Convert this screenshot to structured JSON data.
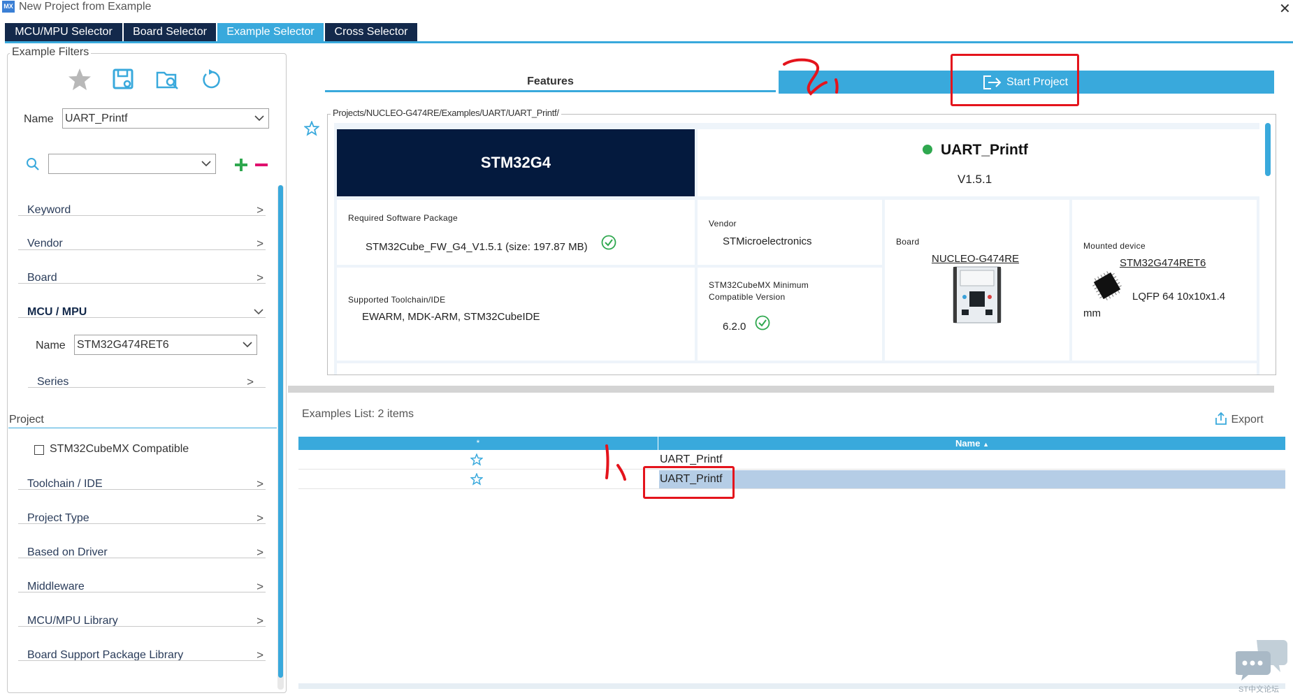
{
  "window": {
    "logo": "MX",
    "title": "New Project from Example",
    "close_glyph": "✕"
  },
  "tabs": [
    {
      "label": "MCU/MPU Selector",
      "active": false
    },
    {
      "label": "Board Selector",
      "active": false
    },
    {
      "label": "Example Selector",
      "active": true
    },
    {
      "label": "Cross Selector",
      "active": false
    }
  ],
  "filters": {
    "legend": "Example Filters",
    "toolbar_icons": [
      "star-icon",
      "save-icon",
      "open-folder-icon",
      "reset-icon"
    ],
    "name_label": "Name",
    "name_value": "UART_Printf",
    "search_value": "",
    "sections_top": [
      {
        "label": "Keyword"
      },
      {
        "label": "Vendor"
      },
      {
        "label": "Board"
      }
    ],
    "mcu_section": {
      "label": "MCU / MPU",
      "name_label": "Name",
      "name_value": "STM32G474RET6",
      "series_label": "Series"
    },
    "project_label": "Project",
    "compatible_label": "STM32CubeMX Compatible",
    "compatible_checked": false,
    "sections_bottom": [
      {
        "label": "Toolchain / IDE"
      },
      {
        "label": "Project Type"
      },
      {
        "label": "Based on Driver"
      },
      {
        "label": "Middleware"
      },
      {
        "label": "MCU/MPU Library"
      },
      {
        "label": "Board Support Package Library"
      }
    ]
  },
  "features_tab": "Features",
  "start_project": "Start Project",
  "detail": {
    "path": "Projects/NUCLEO-G474RE/Examples/UART/UART_Printf/",
    "family": "STM32G4",
    "example_name": "UART_Printf",
    "version": "V1.5.1",
    "required_sw_label": "Required Software Package",
    "required_sw_value": "STM32Cube_FW_G4_V1.5.1  (size: 197.87 MB)",
    "vendor_label": "Vendor",
    "vendor_value": "STMicroelectronics",
    "board_label": "Board",
    "board_value": "NUCLEO-G474RE",
    "mounted_label": "Mounted device",
    "mounted_value": "STM32G474RET6",
    "package_value": "LQFP 64 10x10x1.4",
    "package_unit": "mm",
    "toolchain_label": "Supported Toolchain/IDE",
    "toolchain_value": "EWARM, MDK-ARM, STM32CubeIDE",
    "min_version_label_1": "STM32CubeMX Minimum",
    "min_version_label_2": "Compatible Version",
    "min_version_value": "6.2.0"
  },
  "examples_list": {
    "title": "Examples List: 2 items",
    "export_label": "Export",
    "col_star": "*",
    "col_name": "Name",
    "rows": [
      {
        "name": "UART_Printf",
        "selected": false
      },
      {
        "name": "UART_Printf",
        "selected": true
      }
    ]
  },
  "annotations": {
    "mark_1": "1,",
    "mark_2": "2,"
  },
  "watermark": "ST中文论坛",
  "colors": {
    "accent": "#39a9dc",
    "navy": "#13294b",
    "banner": "#041a3e",
    "status_ok": "#2fa84f",
    "annotation_red": "#e4141c"
  }
}
